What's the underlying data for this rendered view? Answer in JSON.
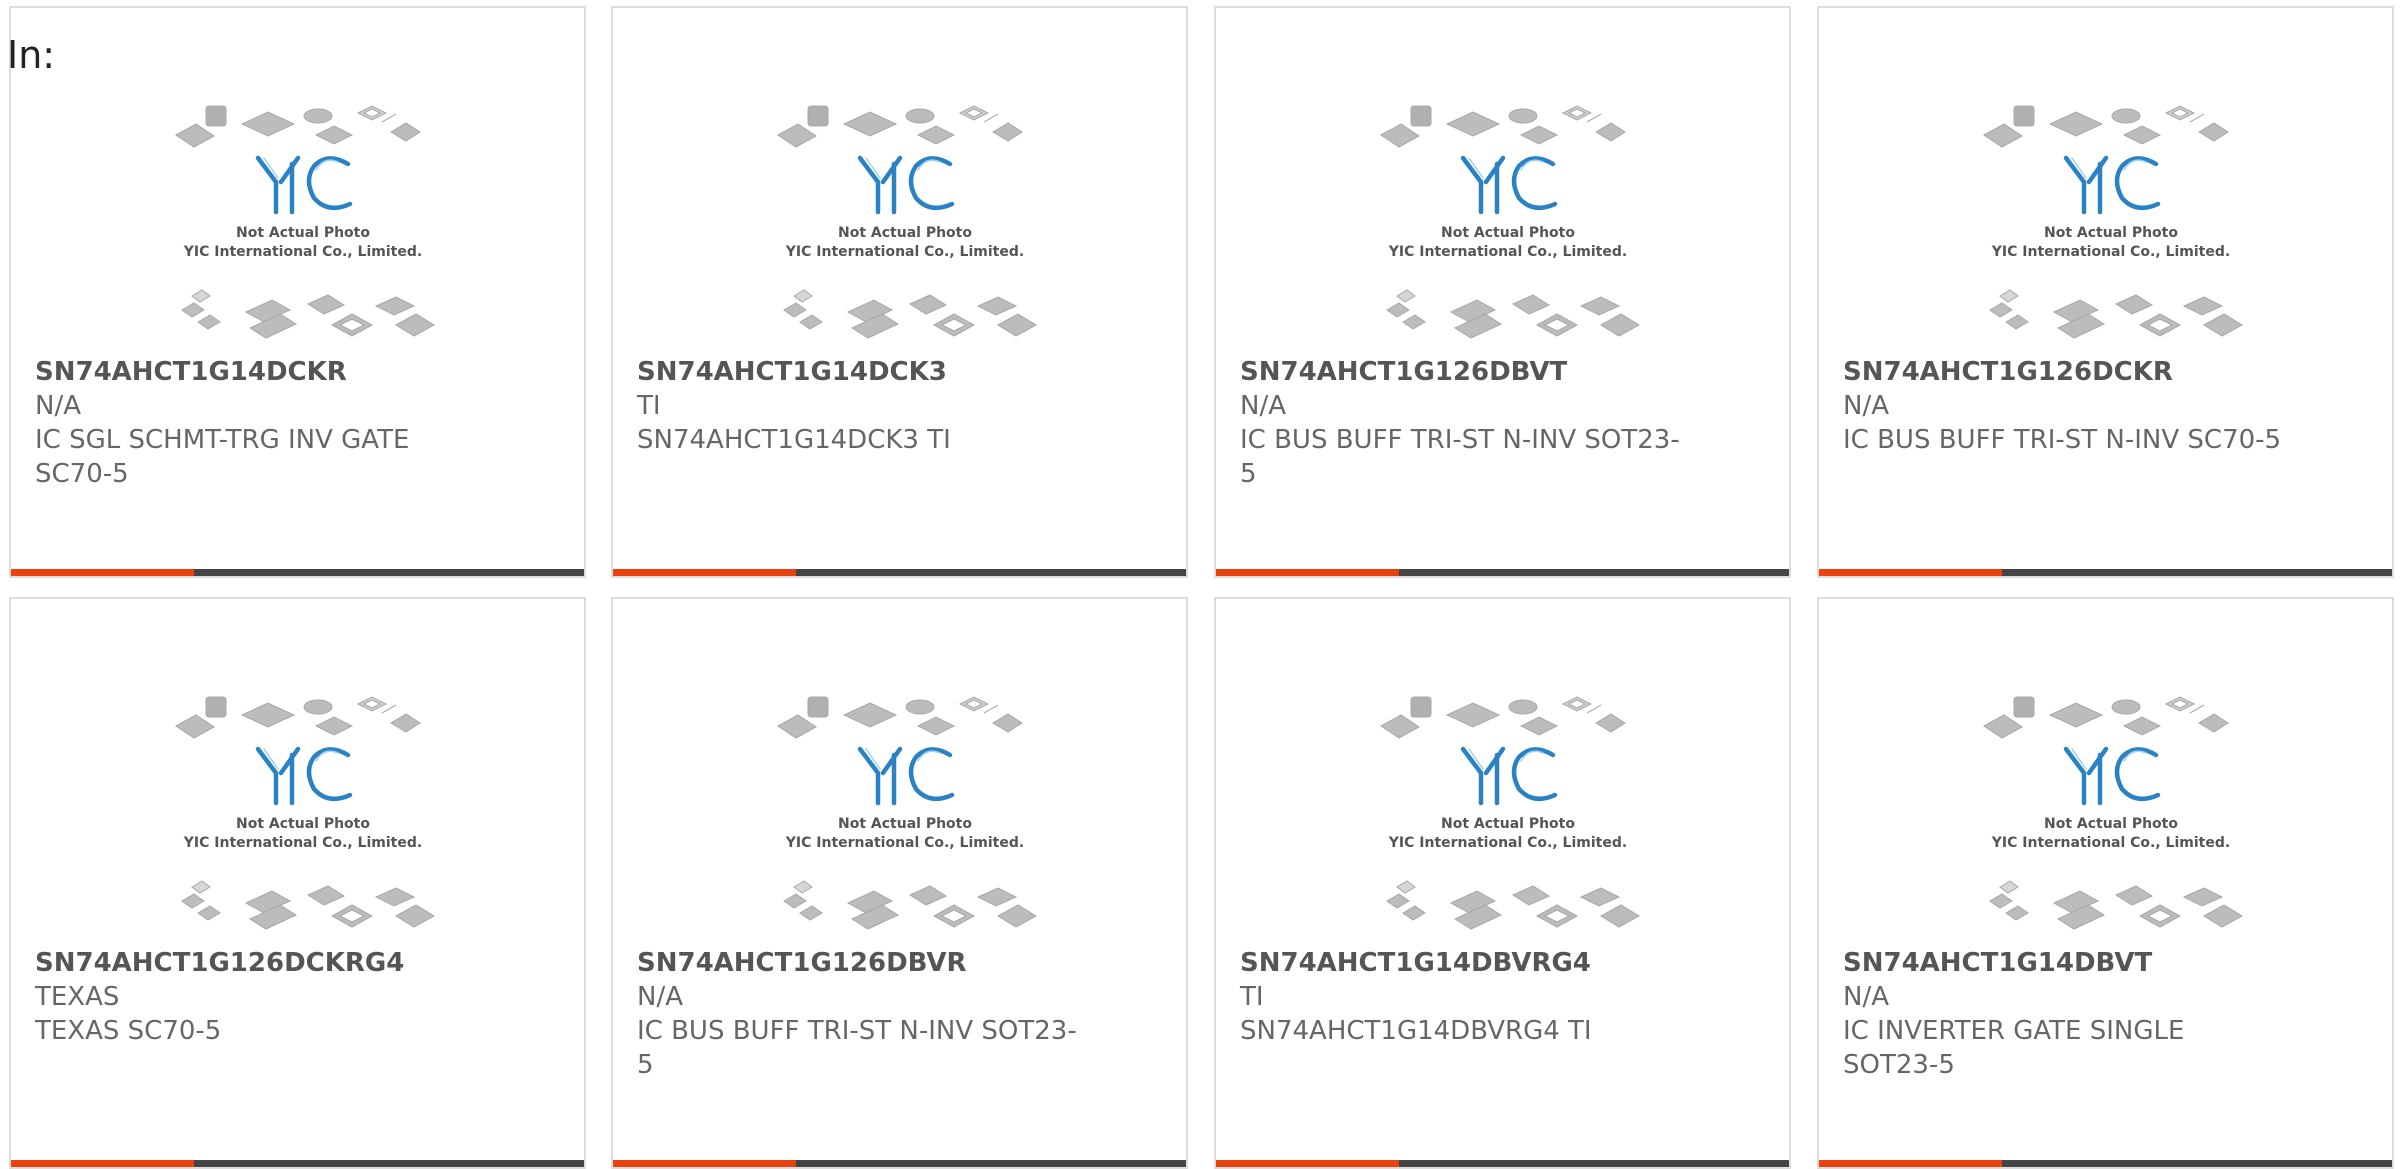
{
  "page": {
    "label": "In:"
  },
  "placeholder_photo": {
    "line1": "Not Actual Photo",
    "line2": "YIC International Co., Limited.",
    "logo_text": "YIC",
    "icon": "chip-packages-placeholder-icon"
  },
  "colors": {
    "accent": "#e8420d",
    "bar": "#444444",
    "logo_blue": "#2a82c4",
    "text": "#666666",
    "border": "#dddddd"
  },
  "products": [
    {
      "part": "SN74AHCT1G14DCKR",
      "manufacturer": "N/A",
      "description": "IC SGL SCHMT-TRG INV GATE SC70-5"
    },
    {
      "part": "SN74AHCT1G14DCK3",
      "manufacturer": "TI",
      "description": "SN74AHCT1G14DCK3 TI"
    },
    {
      "part": "SN74AHCT1G126DBVT",
      "manufacturer": "N/A",
      "description": "IC BUS BUFF TRI-ST N-INV SOT23-5"
    },
    {
      "part": "SN74AHCT1G126DCKR",
      "manufacturer": "N/A",
      "description": "IC BUS BUFF TRI-ST N-INV SC70-5"
    },
    {
      "part": "SN74AHCT1G126DCKRG4",
      "manufacturer": "TEXAS",
      "description": "TEXAS SC70-5"
    },
    {
      "part": "SN74AHCT1G126DBVR",
      "manufacturer": "N/A",
      "description": "IC BUS BUFF TRI-ST N-INV SOT23-5"
    },
    {
      "part": "SN74AHCT1G14DBVRG4",
      "manufacturer": "TI",
      "description": "SN74AHCT1G14DBVRG4 TI"
    },
    {
      "part": "SN74AHCT1G14DBVT",
      "manufacturer": "N/A",
      "description": "IC INVERTER GATE SINGLE SOT23-5"
    }
  ]
}
